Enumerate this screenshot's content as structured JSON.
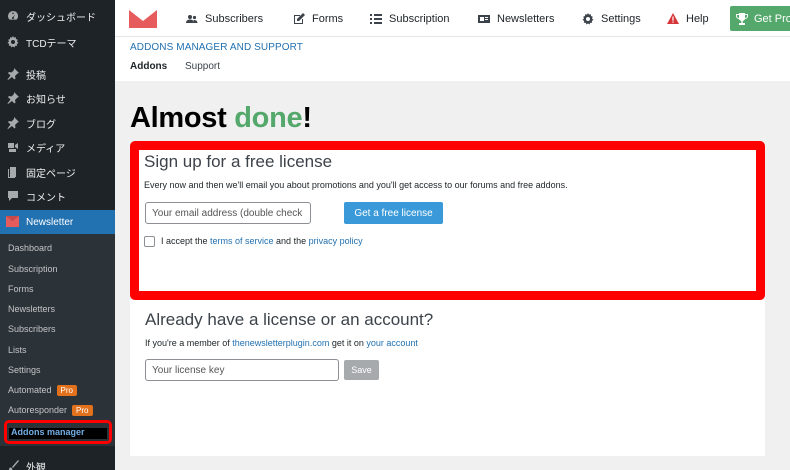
{
  "sidebar": {
    "dashboard": "ダッシュボード",
    "tcd_theme": "TCDテーマ",
    "posts": "投稿",
    "news": "お知らせ",
    "blog": "ブログ",
    "media": "メディア",
    "pages": "固定ページ",
    "comments": "コメント",
    "newsletter": "Newsletter",
    "appearance": "外観",
    "submenu": {
      "dashboard": "Dashboard",
      "subscription": "Subscription",
      "forms": "Forms",
      "newsletters": "Newsletters",
      "subscribers": "Subscribers",
      "lists": "Lists",
      "settings": "Settings",
      "automated": "Automated",
      "autoresponder": "Autoresponder",
      "pro_badge": "Pro",
      "addons_manager": "Addons manager"
    }
  },
  "topbar": {
    "subscribers": "Subscribers",
    "forms": "Forms",
    "subscription": "Subscription",
    "newsletters": "Newsletters",
    "settings": "Settings",
    "help": "Help",
    "get_pro": "Get Pro"
  },
  "header": {
    "section_title": "ADDONS MANAGER AND SUPPORT",
    "tab_addons": "Addons",
    "tab_support": "Support"
  },
  "main": {
    "headline_prefix": "Almost ",
    "headline_accent": "done",
    "headline_suffix": "!",
    "signup": {
      "title": "Sign up for a free license",
      "description": "Every now and then we'll email you about promotions and you'll get access to our forums and free addons.",
      "email_placeholder": "Your email address (double check it!)",
      "button": "Get a free license",
      "accept_prefix": "I accept the ",
      "terms_link": "terms of service",
      "accept_mid": " and the ",
      "privacy_link": "privacy policy"
    },
    "existing": {
      "title": "Already have a license or an account?",
      "desc_prefix": "If you're a member of ",
      "site_link": "thenewsletterplugin.com",
      "desc_mid": " get it on ",
      "account_link": "your account",
      "license_placeholder": "Your license key",
      "save_button": "Save"
    }
  },
  "colors": {
    "accent_green": "#55a86b",
    "wp_blue": "#2271b1",
    "highlight_red": "#ff0000"
  }
}
